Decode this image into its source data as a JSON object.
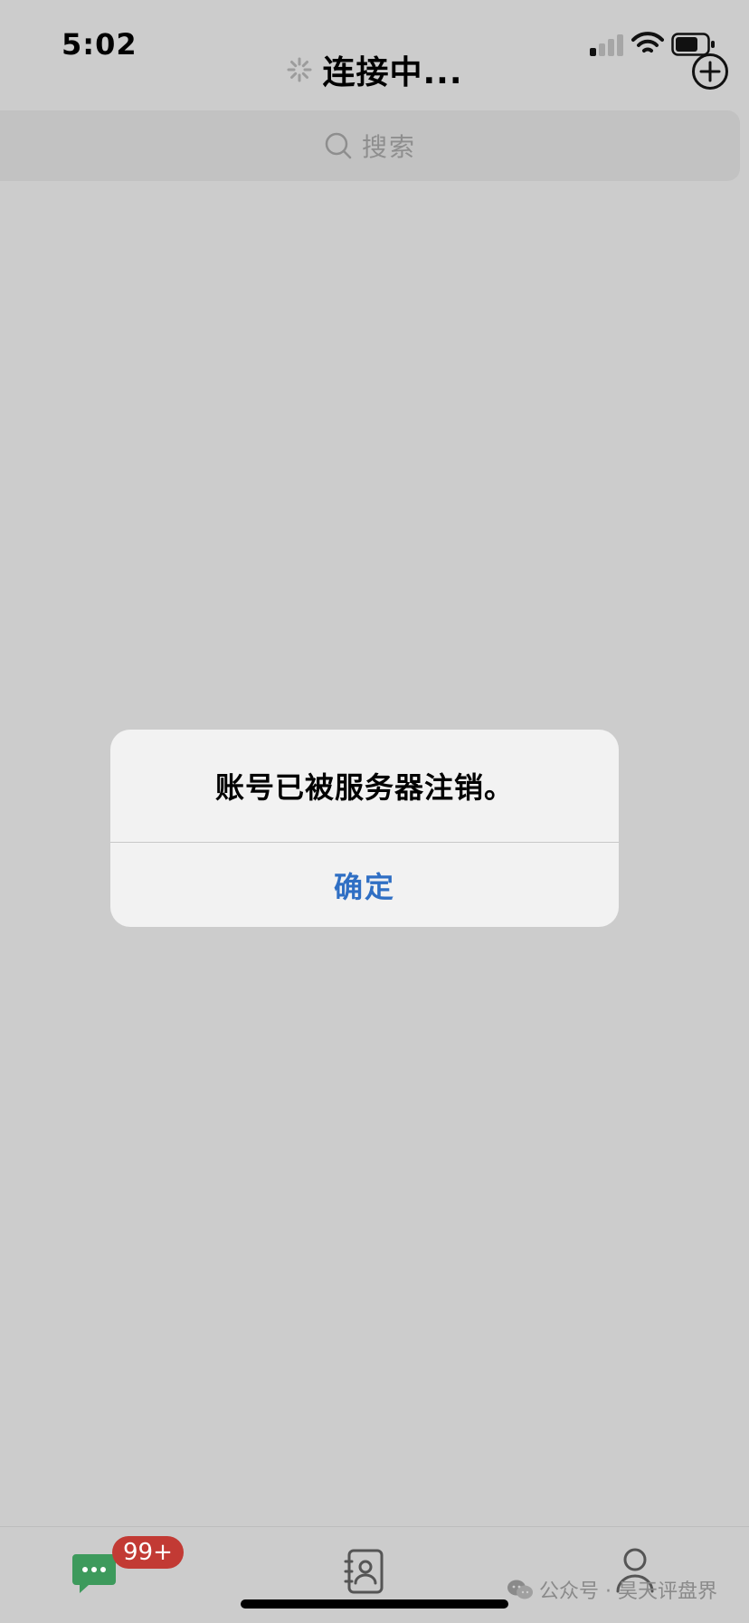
{
  "status_bar": {
    "time": "5:02"
  },
  "nav": {
    "title": "连接中..."
  },
  "search": {
    "placeholder": "搜索"
  },
  "alert": {
    "message": "账号已被服务器注销。",
    "confirm_label": "确定"
  },
  "tab_bar": {
    "chats_badge": "99+"
  },
  "watermark": {
    "text": "公众号 · 昊天评盘界"
  },
  "colors": {
    "background": "#cccccc",
    "alert_background": "#f2f2f2",
    "confirm_blue": "#2f6fc4",
    "chats_green": "#3d9a5c",
    "badge_red": "#c23a34"
  }
}
